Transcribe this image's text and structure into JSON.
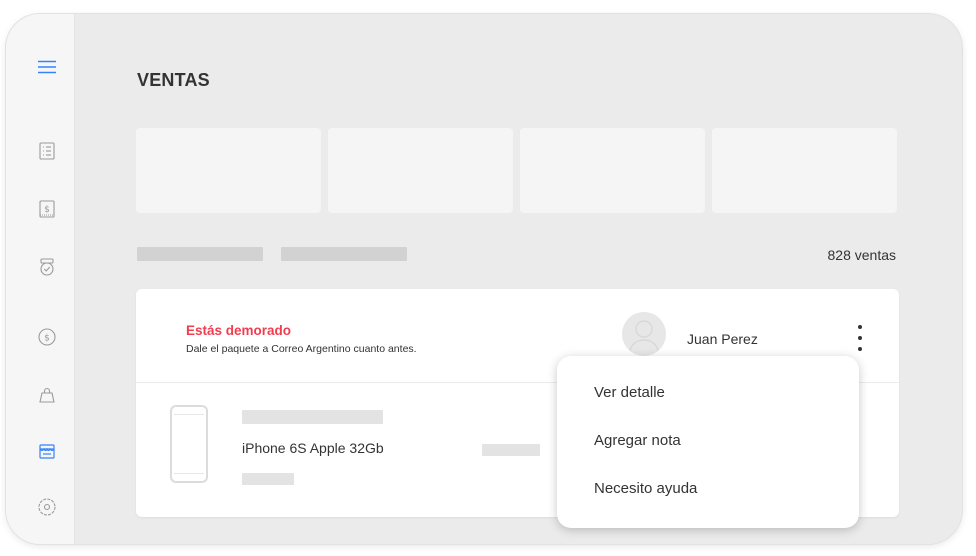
{
  "sidebar": {
    "items": [
      {
        "icon": "menu-icon",
        "color": "#3483fa",
        "active": true
      },
      {
        "icon": "list-icon",
        "color": "#9a9a9a"
      },
      {
        "icon": "invoice-dollar-icon",
        "color": "#9a9a9a"
      },
      {
        "icon": "badge-check-icon",
        "color": "#9a9a9a"
      },
      {
        "icon": "coin-dollar-icon",
        "color": "#9a9a9a"
      },
      {
        "icon": "shopping-bag-icon",
        "color": "#9a9a9a"
      },
      {
        "icon": "store-icon",
        "color": "#3483fa",
        "active": true
      },
      {
        "icon": "settings-circle-icon",
        "color": "#9a9a9a"
      }
    ]
  },
  "page": {
    "title": "VENTAS",
    "sales_count": "828 ventas"
  },
  "sale": {
    "status_title": "Estás demorado",
    "status_message": "Dale el paquete a Correo Argentino cuanto antes.",
    "buyer_name": "Juan Perez",
    "product_name": "iPhone 6S Apple 32Gb"
  },
  "context_menu": {
    "items": [
      {
        "label": "Ver detalle"
      },
      {
        "label": "Agregar nota"
      },
      {
        "label": "Necesito ayuda"
      }
    ]
  },
  "colors": {
    "accent": "#3483fa",
    "warning": "#f23d4f",
    "text": "#333333",
    "placeholder": "#d2d2d2"
  }
}
